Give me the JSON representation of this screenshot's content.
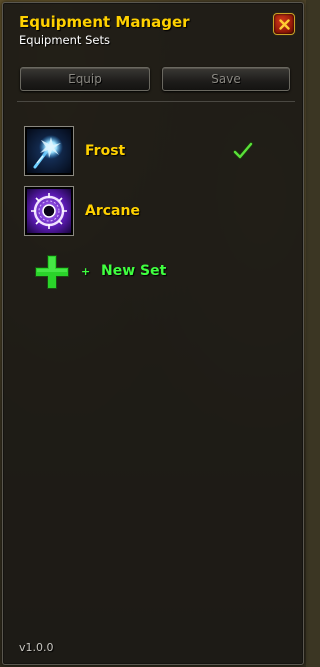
{
  "window": {
    "title": "Equipment Manager",
    "subtitle": "Equipment Sets",
    "close_icon": "close-icon"
  },
  "toolbar": {
    "equip_label": "Equip",
    "save_label": "Save"
  },
  "sets": [
    {
      "name": "Frost",
      "icon": "frost-spell-icon",
      "active": true,
      "active_icon": "checkmark-icon"
    },
    {
      "name": "Arcane",
      "icon": "arcane-spell-icon",
      "active": false
    }
  ],
  "new_set": {
    "prefix": "+",
    "label": "New Set",
    "icon": "plus-icon"
  },
  "footer": {
    "version": "v1.0.0"
  },
  "colors": {
    "title": "#ffd100",
    "set_name": "#ffd100",
    "new_set": "#40ff40",
    "check": "#4ad82a",
    "button_text_disabled": "#8a8882"
  }
}
